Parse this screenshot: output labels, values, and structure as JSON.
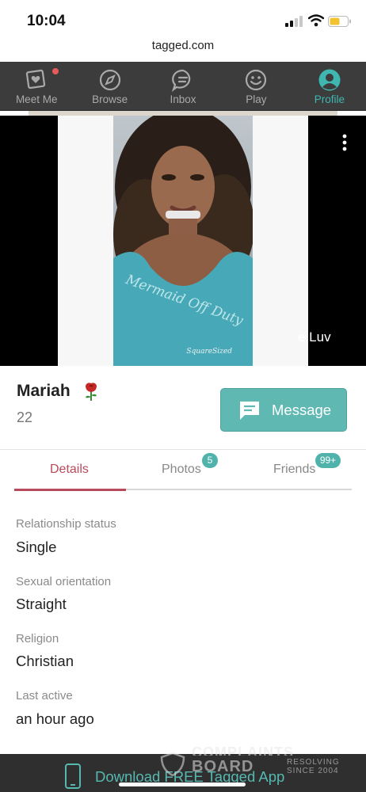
{
  "status_bar": {
    "time": "10:04"
  },
  "browser": {
    "url": "tagged.com"
  },
  "nav": {
    "items": [
      {
        "label": "Meet Me",
        "icon": "meet-me-icon"
      },
      {
        "label": "Browse",
        "icon": "compass-icon"
      },
      {
        "label": "Inbox",
        "icon": "chat-icon"
      },
      {
        "label": "Play",
        "icon": "smiley-icon"
      },
      {
        "label": "Profile",
        "icon": "profile-icon"
      }
    ],
    "active": "Profile"
  },
  "photo": {
    "caption_partial": "e Luv",
    "shirt_text": "Mermaid Off Duty",
    "signature": "SquareSized"
  },
  "profile": {
    "name": "Mariah",
    "age": "22",
    "message_label": "Message"
  },
  "tabs": [
    {
      "label": "Details",
      "badge": ""
    },
    {
      "label": "Photos",
      "badge": "5"
    },
    {
      "label": "Friends",
      "badge": "99+"
    }
  ],
  "details": [
    {
      "label": "Relationship status",
      "value": "Single"
    },
    {
      "label": "Sexual orientation",
      "value": "Straight"
    },
    {
      "label": "Religion",
      "value": "Christian"
    },
    {
      "label": "Last active",
      "value": "an hour ago"
    }
  ],
  "footer": {
    "download_text": "Download FREE Tagged App"
  },
  "watermark": {
    "top": "COMPLAINTS",
    "title": "BOARD",
    "sub1": "RESOLVING",
    "sub2": "SINCE 2004"
  },
  "colors": {
    "accent": "#5fb9b2",
    "active_tab": "#b84a5b",
    "nav_bg": "#3c3c3c"
  }
}
